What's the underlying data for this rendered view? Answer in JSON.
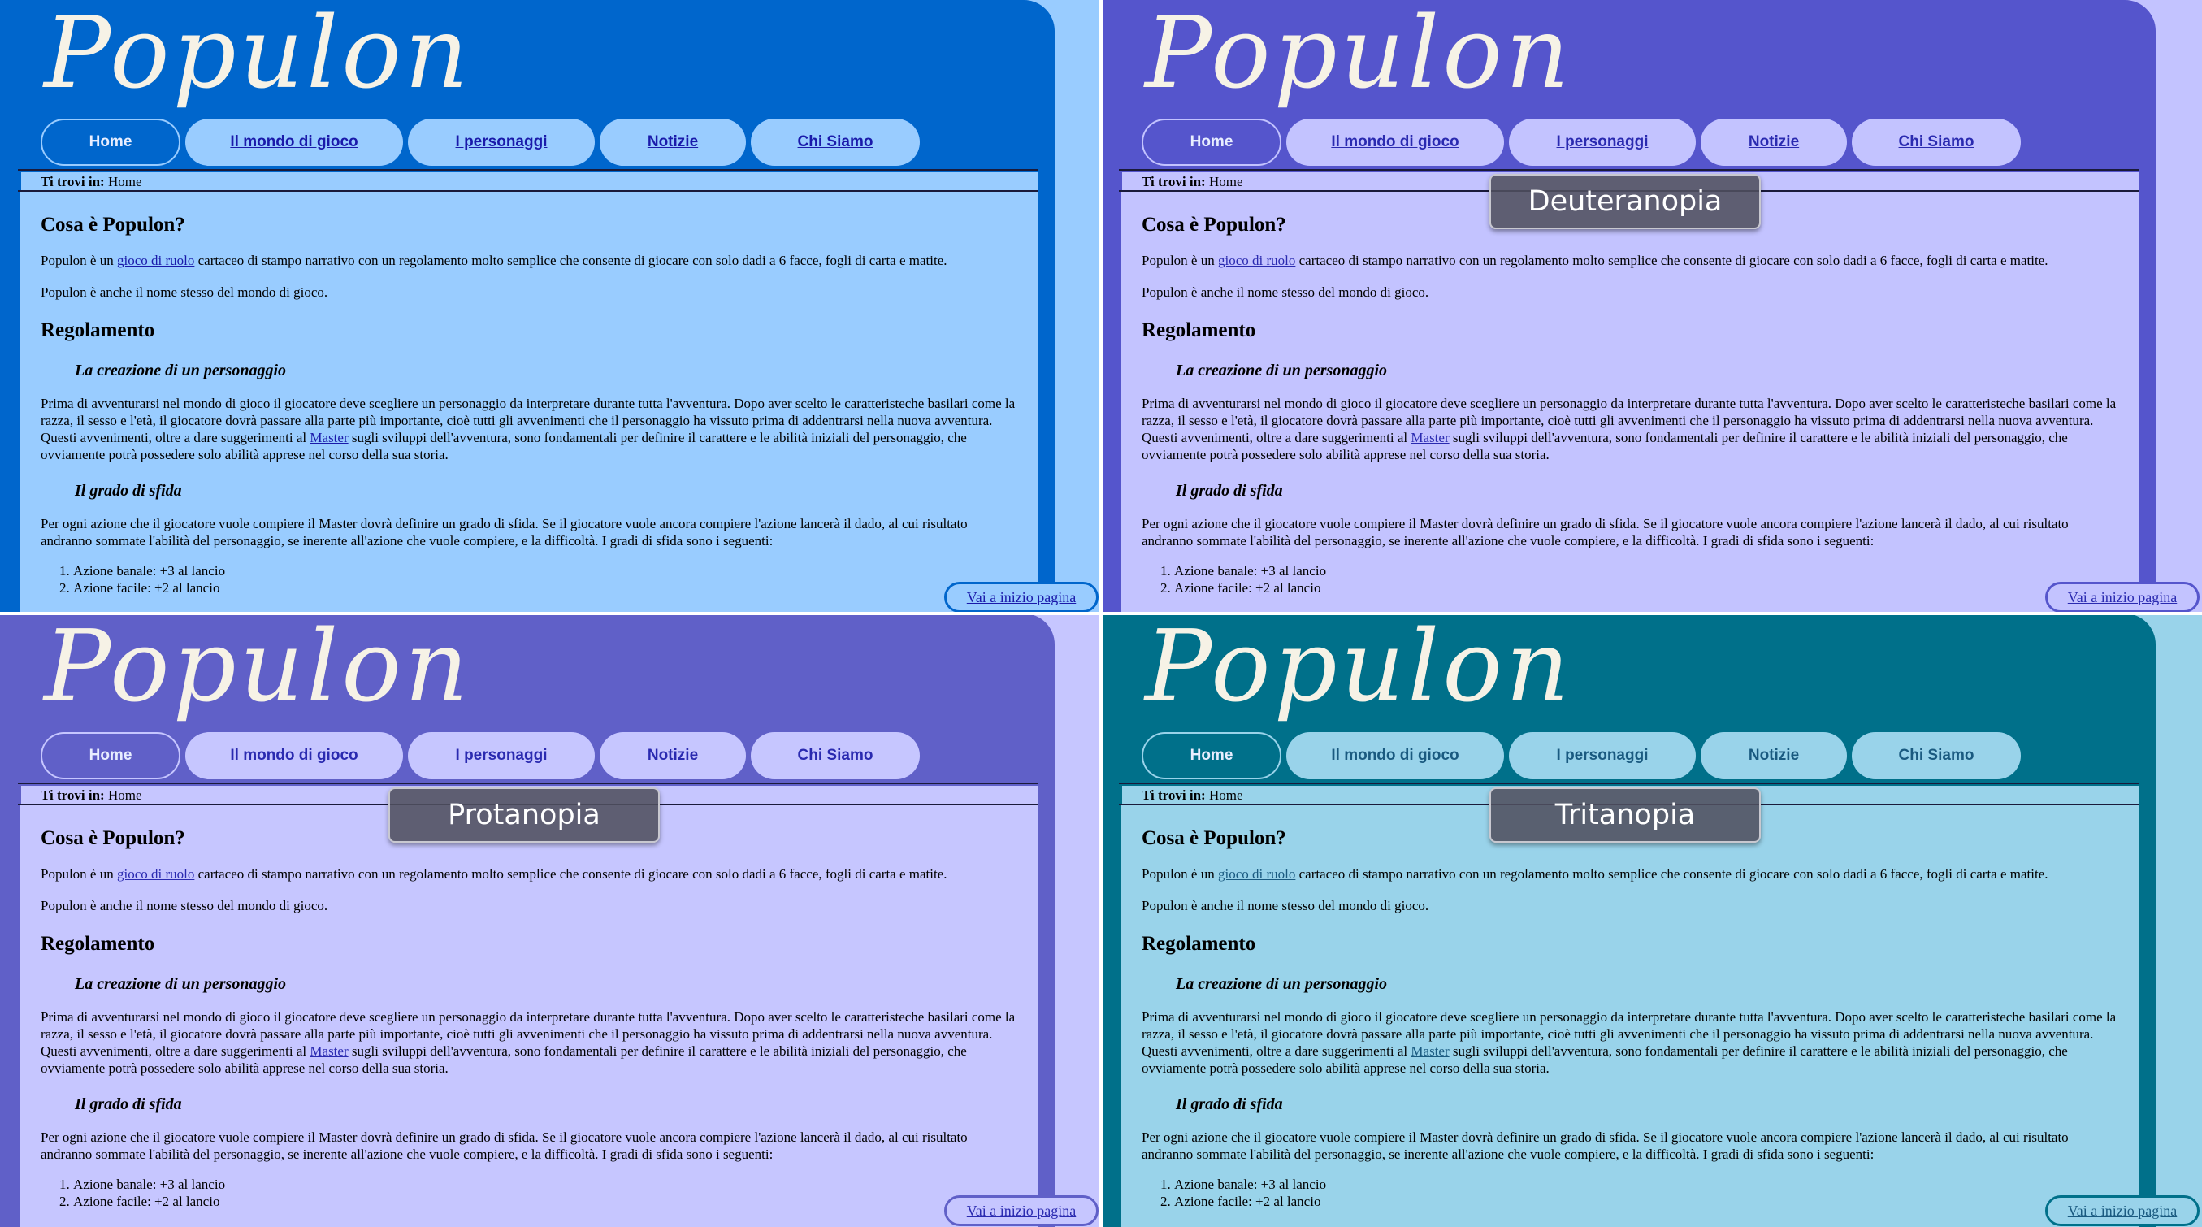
{
  "site": {
    "logo_text": "Populon",
    "nav": [
      "Home",
      "Il mondo di gioco",
      "I personaggi",
      "Notizie",
      "Chi Siamo"
    ],
    "breadcrumb_label": "Ti trovi in:",
    "breadcrumb_value": "Home",
    "content": {
      "h1": "Cosa è Populon?",
      "p1_before": "Populon è un ",
      "p1_link": "gioco di ruolo",
      "p1_after": " cartaceo di stampo narrativo con un regolamento molto semplice che consente di giocare con solo dadi a 6 facce, fogli di carta e matite.",
      "p2": "Populon è anche il nome stesso del mondo di gioco.",
      "h2": "Regolamento",
      "h3a": "La creazione di un personaggio",
      "p3_before": "Prima di avventurarsi nel mondo di gioco il giocatore deve scegliere un personaggio da interpretare durante tutta l'avventura. Dopo aver scelto le caratteristeche basilari come la razza, il sesso e l'età, il giocatore dovrà passare alla parte più importante, cioè tutti gli avvenimenti che il personaggio ha vissuto prima di addentrarsi nella nuova avventura. Questi avvenimenti, oltre a dare suggerimenti al ",
      "p3_link": "Master",
      "p3_after": " sugli sviluppi dell'avventura, sono fondamentali per definire il carattere e le abilità iniziali del personaggio, che ovviamente potrà possedere solo abilità apprese nel corso della sua storia.",
      "h3b": "Il grado di sfida",
      "p4": "Per ogni azione che il giocatore vuole compiere il Master dovrà definire un grado di sfida. Se il giocatore vuole ancora compiere l'azione lancerà il dado, al cui risultato andranno sommate l'abilità del personaggio, se inerente all'azione che vuole compiere, e la difficoltà. I gradi di sfida sono i seguenti:",
      "list": [
        "Azione banale: +3 al lancio",
        "Azione facile: +2 al lancio"
      ]
    },
    "back_to_top": "Vai a inizio pagina"
  },
  "panels": [
    {
      "label": "",
      "colors": {
        "main": "#0066cc",
        "bg": "#99ccff",
        "tab": "#99ccff",
        "link": "#1a1aaa"
      }
    },
    {
      "label": "Deuteranopia",
      "colors": {
        "main": "#5555cc",
        "bg": "#c3c3ff",
        "tab": "#c3c3ff",
        "link": "#2a2ab0"
      }
    },
    {
      "label": "Protanopia",
      "colors": {
        "main": "#6060c8",
        "bg": "#c6c6ff",
        "tab": "#c6c6ff",
        "link": "#2a2ab0"
      }
    },
    {
      "label": "Tritanopia",
      "colors": {
        "main": "#00708a",
        "bg": "#99d3ea",
        "tab": "#99d3ea",
        "link": "#1a5a80"
      }
    }
  ]
}
